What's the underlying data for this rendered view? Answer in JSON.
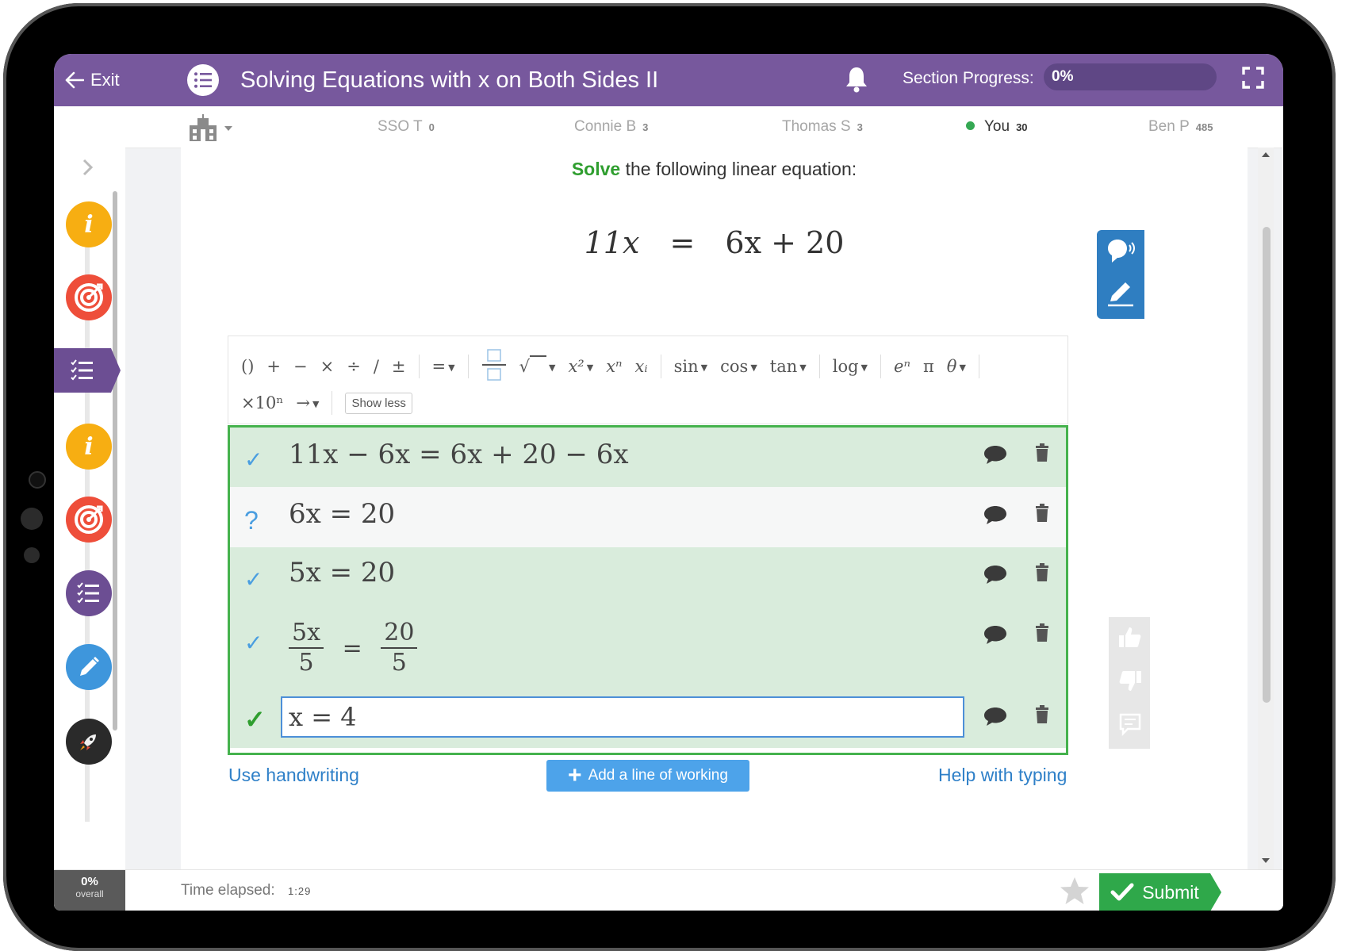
{
  "header": {
    "exit_label": "Exit",
    "title": "Solving Equations with x on Both Sides II",
    "progress_label": "Section Progress:",
    "progress_value": "0%",
    "accent": "#77589d"
  },
  "leaderboard": [
    {
      "name": "SSO T",
      "score": "0"
    },
    {
      "name": "Connie B",
      "score": "3"
    },
    {
      "name": "Thomas S",
      "score": "3"
    },
    {
      "name": "You",
      "score": "30"
    },
    {
      "name": "Ben P",
      "score": "485"
    }
  ],
  "rail": {
    "info_glyph": "i",
    "icons": [
      "chevron-right-icon",
      "info-icon",
      "target-icon",
      "list-icon",
      "info-icon",
      "target-icon",
      "list-icon",
      "pencil-icon",
      "rocket-icon"
    ]
  },
  "question": {
    "prompt_bold": "Solve",
    "prompt_rest": " the following linear equation:",
    "lhs": "11x",
    "eq": "=",
    "rhs": "6x + 20"
  },
  "toolbar": {
    "row1": [
      "()",
      "+",
      "−",
      "×",
      "÷",
      "/",
      "±",
      "=",
      "√",
      "x²",
      "xⁿ",
      "xᵢ",
      "sin",
      "cos",
      "tan",
      "log",
      "eⁿ",
      "π",
      "θ"
    ],
    "row2": [
      "×10ⁿ",
      "→"
    ],
    "show_less": "Show less"
  },
  "steps": [
    {
      "status": "correct",
      "status_glyph": "✓",
      "expr": "11x − 6x = 6x + 20 − 6x"
    },
    {
      "status": "unknown",
      "status_glyph": "?",
      "expr": "6x = 20"
    },
    {
      "status": "correct",
      "status_glyph": "✓",
      "expr": "5x = 20"
    },
    {
      "status": "correct",
      "status_glyph": "✓",
      "frac1_num": "5x",
      "frac1_den": "5",
      "eq": "=",
      "frac2_num": "20",
      "frac2_den": "5"
    },
    {
      "status": "final",
      "status_glyph": "✓",
      "input_value": "x = 4"
    }
  ],
  "actions": {
    "handwriting": "Use handwriting",
    "add_line": "Add a line of working",
    "help_typing": "Help with typing"
  },
  "footer": {
    "overall_value": "0%",
    "overall_label": "overall",
    "time_label": "Time elapsed:",
    "time_value": "1:29",
    "submit": "Submit"
  }
}
